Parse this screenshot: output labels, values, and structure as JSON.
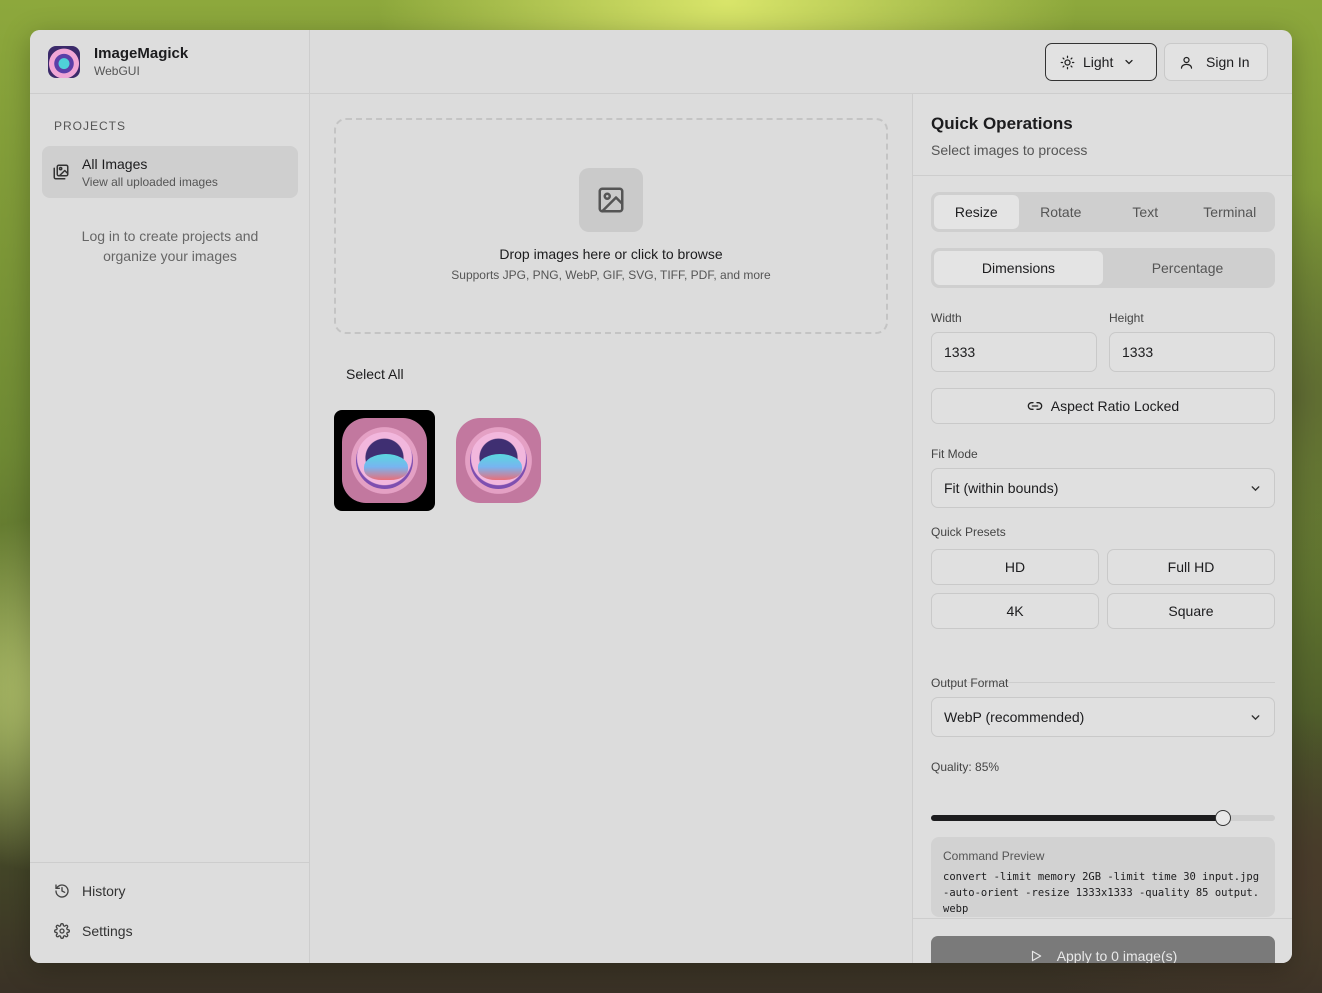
{
  "app": {
    "name": "ImageMagick",
    "subtitle": "WebGUI"
  },
  "sidebar": {
    "section_label": "PROJECTS",
    "project": {
      "name": "All Images",
      "description": "View all uploaded images"
    },
    "login_note": "Log in to create projects and organize your images",
    "bottom_links": [
      {
        "label": "History",
        "icon": "history-icon"
      },
      {
        "label": "Settings",
        "icon": "gear-icon"
      }
    ]
  },
  "topbar": {
    "theme_label": "Light",
    "signin_label": "Sign In"
  },
  "dropzone": {
    "title": "Drop images here or click to browse",
    "subtitle": "Supports JPG, PNG, WebP, GIF, SVG, TIFF, PDF, and more"
  },
  "gallery": {
    "select_all_label": "Select All",
    "thumbnail_count": 2
  },
  "panel": {
    "title": "Quick Operations",
    "subtitle": "Select images to process",
    "tabs": [
      "Resize",
      "Rotate",
      "Text",
      "Terminal"
    ],
    "active_tab": "Resize",
    "subtabs": [
      "Dimensions",
      "Percentage"
    ],
    "active_subtab": "Dimensions",
    "width_label": "Width",
    "width_value": "1333",
    "height_label": "Height",
    "height_value": "1333",
    "aspect_label": "Aspect Ratio Locked",
    "fit_mode_label": "Fit Mode",
    "fit_mode_value": "Fit (within bounds)",
    "presets_label": "Quick Presets",
    "presets": [
      "HD",
      "Full HD",
      "4K",
      "Square"
    ],
    "output_format_label": "Output Format",
    "output_format_value": "WebP (recommended)",
    "quality_label": "Quality: 85%",
    "quality_value": 85,
    "command_label": "Command Preview",
    "command_text": "convert -limit memory 2GB -limit time 30 input.jpg -auto-orient -resize 1333x1333 -quality 85 output.webp",
    "apply_label": "Apply to 0 image(s)"
  },
  "colors": {
    "accent": "#1c1c1e",
    "apply_button": "#7a7a7a"
  }
}
